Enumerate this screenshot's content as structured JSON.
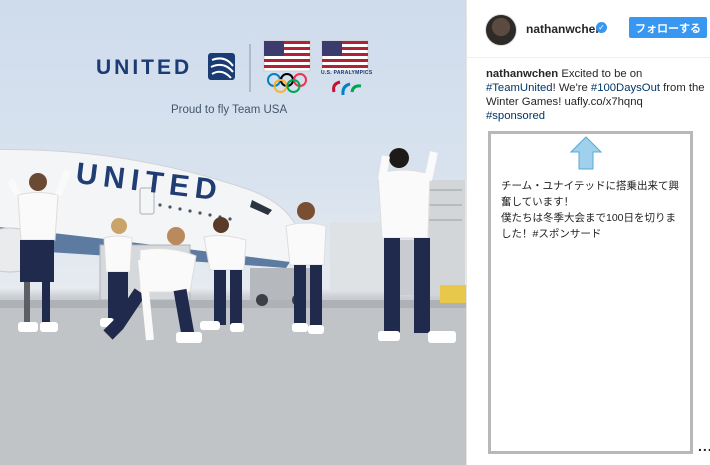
{
  "photo": {
    "brand_wordmark": "UNITED",
    "tagline": "Proud to fly Team USA",
    "paralympics_caption": "U.S. PARALYMPICS",
    "plane_livery": "UNITED"
  },
  "post": {
    "username": "nathanwchen",
    "follow_label": "フォローする",
    "caption_user": "nathanwchen",
    "caption_text_1": " Excited to be on ",
    "hashtag_team": "#TeamUnited",
    "caption_text_2": "! We're ",
    "hashtag_days": "#100DaysOut",
    "caption_text_3": " from the Winter Games! uafly.co/x7hqnq",
    "hashtag_sponsored": "#sponsored",
    "more_label": "..."
  },
  "translation_note": {
    "line_1": "チーム・ユナイテッドに搭乗出来て興奮しています！",
    "line_2": "僕たちは冬季大会まで100日を切りました！#スポンサード"
  },
  "colors": {
    "brand_navy": "#1a3b73",
    "follow_blue": "#3897f0",
    "hashtag": "#003569",
    "arrow_fill": "#9fd0ec"
  },
  "icons": [
    "verified-badge-icon",
    "up-arrow-icon",
    "more-options-icon",
    "olympic-rings-icon",
    "us-flag-icon",
    "globe-logo-icon"
  ]
}
